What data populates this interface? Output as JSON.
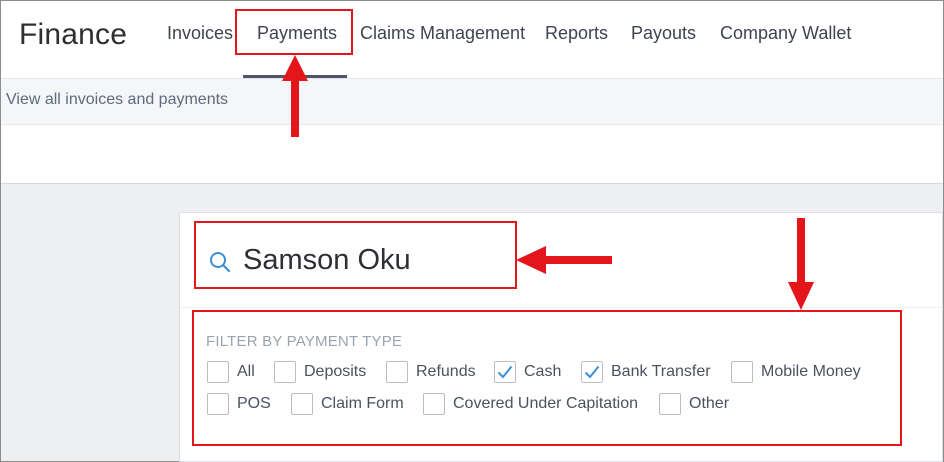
{
  "header": {
    "title": "Finance",
    "nav": [
      {
        "label": "Invoices"
      },
      {
        "label": "Payments"
      },
      {
        "label": "Claims Management"
      },
      {
        "label": "Reports"
      },
      {
        "label": "Payouts"
      },
      {
        "label": "Company Wallet"
      }
    ],
    "active_tab": "Payments"
  },
  "subheader": {
    "text": "View all invoices and payments"
  },
  "search": {
    "value": "Samson Oku",
    "icon": "search-icon"
  },
  "filter": {
    "title": "FILTER BY PAYMENT TYPE",
    "options": [
      {
        "label": "All",
        "checked": false
      },
      {
        "label": "Deposits",
        "checked": false
      },
      {
        "label": "Refunds",
        "checked": false
      },
      {
        "label": "Cash",
        "checked": true
      },
      {
        "label": "Bank Transfer",
        "checked": true
      },
      {
        "label": "Mobile Money",
        "checked": false
      },
      {
        "label": "POS",
        "checked": false
      },
      {
        "label": "Claim Form",
        "checked": false
      },
      {
        "label": "Covered Under Capitation",
        "checked": false
      },
      {
        "label": "Other",
        "checked": false
      }
    ]
  },
  "colors": {
    "annotation": "#e4151b",
    "checkmark": "#3b8fd8",
    "active_underline": "#4e5566"
  }
}
